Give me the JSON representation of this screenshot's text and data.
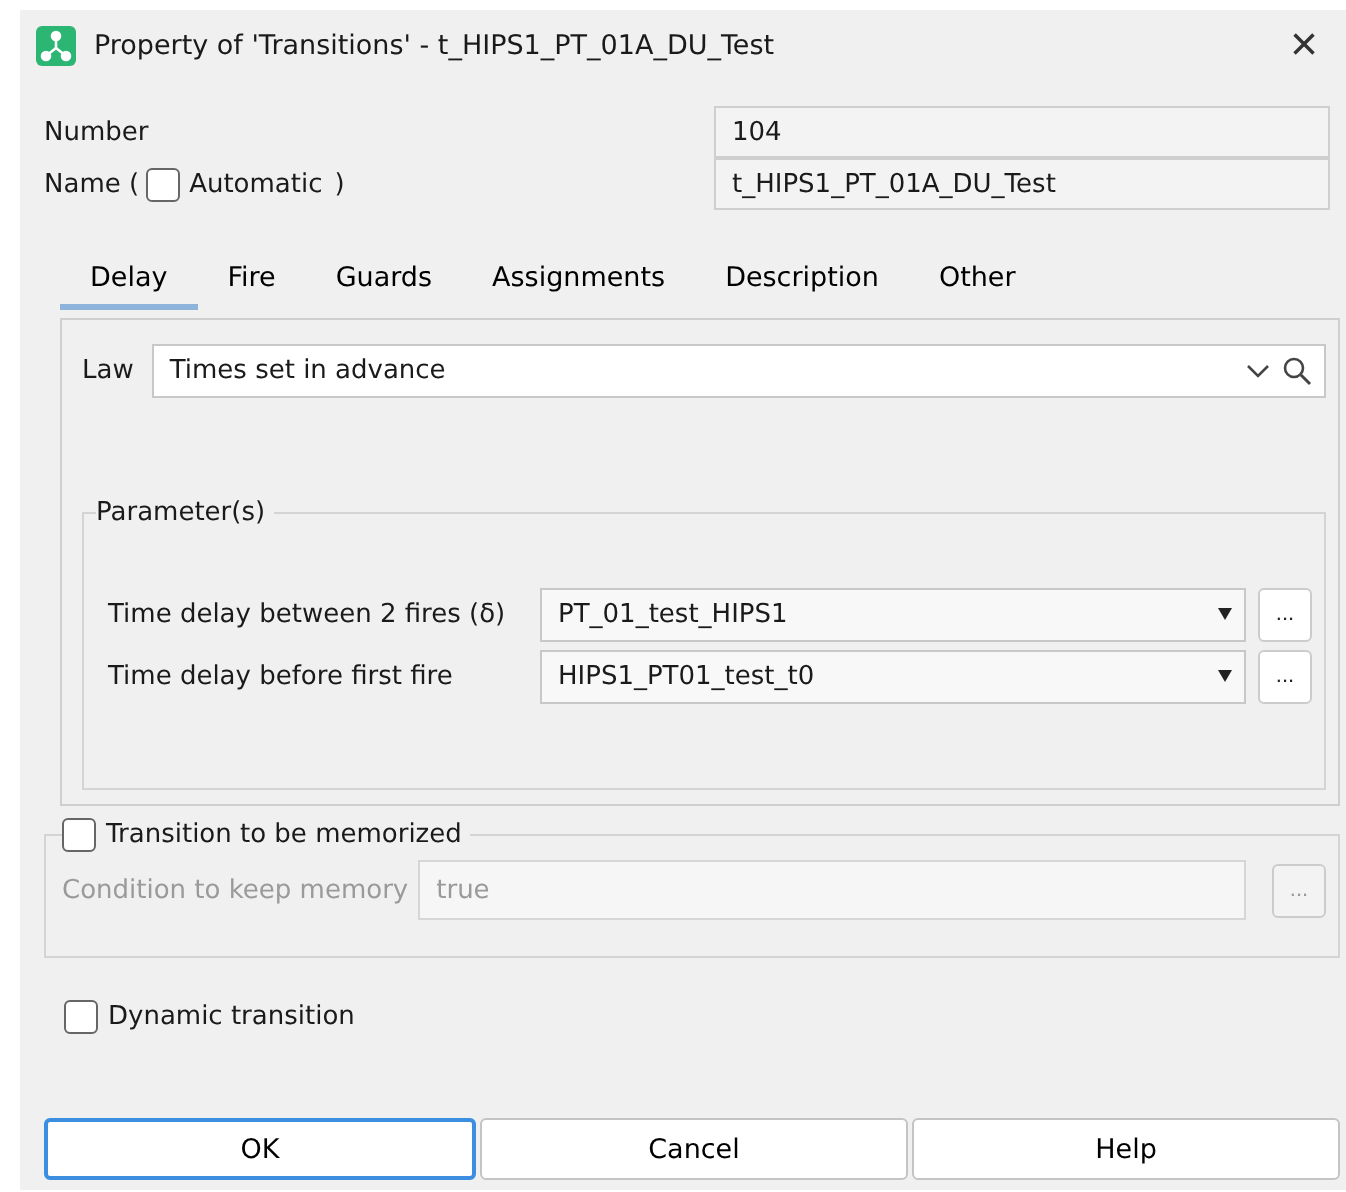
{
  "window": {
    "title": "Property of 'Transitions' - t_HIPS1_PT_01A_DU_Test",
    "close": "×"
  },
  "number": {
    "label": "Number",
    "value": "104"
  },
  "name": {
    "label_before": "Name (",
    "automatic_label": "Automatic",
    "label_after": ")",
    "automatic": false,
    "value": "t_HIPS1_PT_01A_DU_Test"
  },
  "tabs": [
    {
      "label": "Delay",
      "selected": true
    },
    {
      "label": "Fire",
      "selected": false
    },
    {
      "label": "Guards",
      "selected": false
    },
    {
      "label": "Assignments",
      "selected": false
    },
    {
      "label": "Description",
      "selected": false
    },
    {
      "label": "Other",
      "selected": false
    }
  ],
  "law": {
    "label": "Law",
    "value": "Times set in advance"
  },
  "parameters": {
    "title": "Parameter(s)",
    "rows": [
      {
        "label": "Time delay between 2 fires (δ)",
        "value": "PT_01_test_HIPS1",
        "button": "..."
      },
      {
        "label": "Time delay before first fire",
        "value": "HIPS1_PT01_test_t0",
        "button": "..."
      }
    ]
  },
  "memorized": {
    "label": "Transition to be memorized",
    "checked": false,
    "disabled": true,
    "condition_label": "Condition to keep memory",
    "condition_value": "true",
    "button": "..."
  },
  "dynamic": {
    "label": "Dynamic transition",
    "checked": false
  },
  "buttons": [
    {
      "label": "OK",
      "default": true
    },
    {
      "label": "Cancel",
      "default": false
    },
    {
      "label": "Help",
      "default": false
    }
  ]
}
